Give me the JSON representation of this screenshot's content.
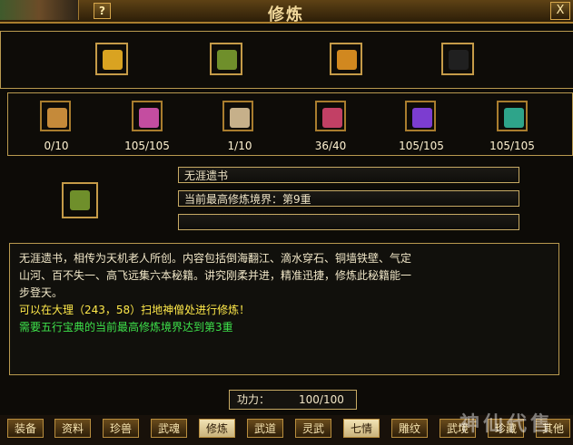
{
  "window": {
    "title": "修炼",
    "help_label": "?",
    "close_label": "X"
  },
  "top_slots": [
    {
      "icon": "golden-book-icon",
      "color": "#d9a321"
    },
    {
      "icon": "green-scroll-bundle-icon",
      "color": "#6f8f2b"
    },
    {
      "icon": "golden-chest-icon",
      "color": "#d1881f"
    },
    {
      "icon": "empty-slot-icon",
      "color": "#202020"
    }
  ],
  "scrolls": [
    {
      "count": "0/10",
      "color": "#c58a3a"
    },
    {
      "count": "105/105",
      "color": "#c44da0"
    },
    {
      "count": "1/10",
      "color": "#c6b08a"
    },
    {
      "count": "36/40",
      "color": "#c24065"
    },
    {
      "count": "105/105",
      "color": "#7c3dd0"
    },
    {
      "count": "105/105",
      "color": "#2ea48a"
    }
  ],
  "selected_item": {
    "name": "无涯遗书",
    "realm": "当前最高修炼境界：第9重",
    "extra": ""
  },
  "description": {
    "line1": "无涯遗书，相传为天机老人所创。内容包括倒海翻江、滴水穿石、铜墙铁壁、气定",
    "line2": "山河、百不失一、高飞远集六本秘籍。讲究刚柔并进，精准迅捷，修炼此秘籍能一",
    "line3": "步登天。",
    "hint1": "可以在大理（243，58）扫地神僧处进行修炼！",
    "hint2": "需要五行宝典的当前最高修炼境界达到第3重",
    "hint1_color": "#ffe94a",
    "hint2_color": "#3ee24b"
  },
  "power": {
    "label": "功力：",
    "value": "100/100"
  },
  "tabs": [
    {
      "label": "装备"
    },
    {
      "label": "资料"
    },
    {
      "label": "珍兽"
    },
    {
      "label": "武魂"
    },
    {
      "label": "修炼"
    },
    {
      "label": "武道"
    },
    {
      "label": "灵武"
    },
    {
      "label": "七情"
    },
    {
      "label": "雕纹"
    },
    {
      "label": "武境"
    },
    {
      "label": "珍藏"
    },
    {
      "label": "其他"
    }
  ],
  "active_tab": "修炼",
  "watermark": "神仙代售"
}
